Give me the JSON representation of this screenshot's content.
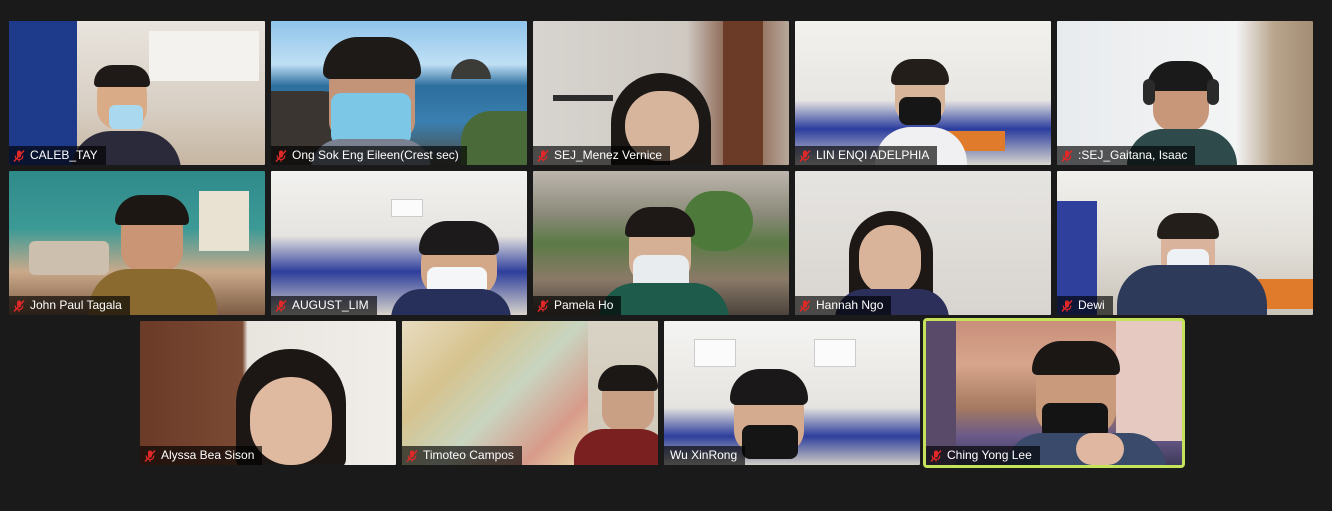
{
  "meeting": {
    "participants": [
      {
        "name": "CALEB_TAY",
        "muted": true
      },
      {
        "name": "Ong Sok Eng Eileen(Crest sec)",
        "muted": true
      },
      {
        "name": "SEJ_Menez Vernice",
        "muted": true
      },
      {
        "name": "LIN ENQI ADELPHIA",
        "muted": true
      },
      {
        "name": ":SEJ_Gaitana, Isaac",
        "muted": true
      },
      {
        "name": "John Paul Tagala",
        "muted": true
      },
      {
        "name": "AUGUST_LIM",
        "muted": true
      },
      {
        "name": "Pamela Ho",
        "muted": true
      },
      {
        "name": "Hannah Ngo",
        "muted": true
      },
      {
        "name": "Dewi",
        "muted": true
      },
      {
        "name": "Alyssa Bea Sison",
        "muted": true
      },
      {
        "name": "Timoteo Campos",
        "muted": true
      },
      {
        "name": "Wu XinRong",
        "muted": false
      },
      {
        "name": "Ching Yong Lee",
        "muted": true,
        "active_speaker": true
      }
    ]
  },
  "icons": {
    "mute": "microphone-muted-icon"
  },
  "colors": {
    "background": "#1a1a1a",
    "active_speaker_border": "#c4e35a",
    "mute_icon": "#e02828"
  }
}
